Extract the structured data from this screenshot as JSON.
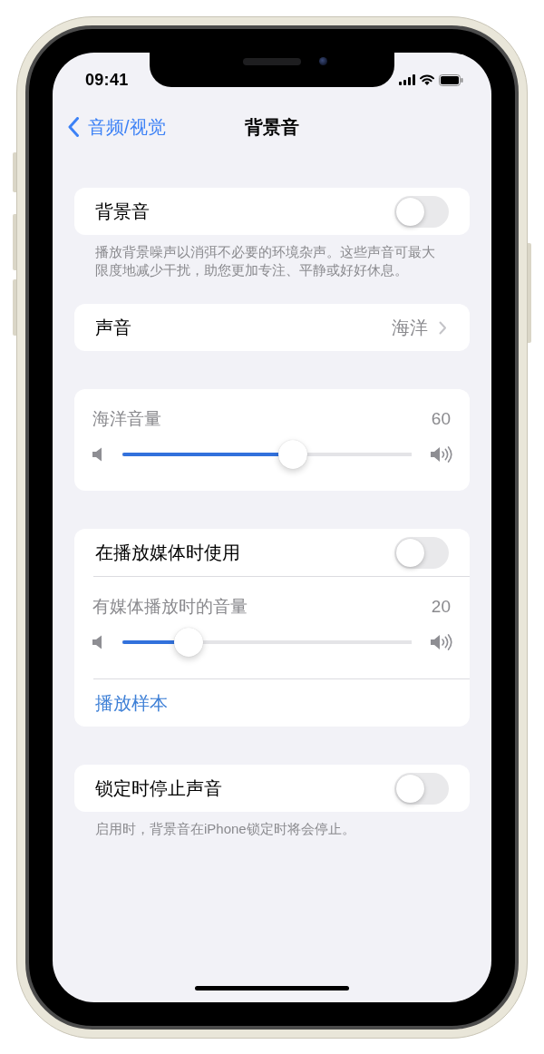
{
  "status_bar": {
    "time": "09:41"
  },
  "nav_bar": {
    "back_label": "音频/视觉",
    "title": "背景音"
  },
  "groups": [
    {
      "rows": [
        {
          "kind": "toggle",
          "label": "背景音",
          "on": false
        }
      ],
      "footer": "播放背景噪声以消弭不必要的环境杂声。这些声音可最大限度地减少干扰，助您更加专注、平静或好好休息。"
    },
    {
      "rows": [
        {
          "kind": "disclosure",
          "label": "声音",
          "value": "海洋"
        }
      ]
    },
    {
      "rows": [
        {
          "kind": "slider",
          "label": "海洋音量",
          "reading": "60",
          "level": 0.6
        }
      ]
    },
    {
      "rows": [
        {
          "kind": "toggle",
          "label": "在播放媒体时使用",
          "on": false
        },
        {
          "kind": "slider",
          "label": "有媒体播放时的音量",
          "reading": "20",
          "level": 0.2
        },
        {
          "kind": "link",
          "label": "播放样本"
        }
      ]
    },
    {
      "rows": [
        {
          "kind": "toggle",
          "label": "锁定时停止声音",
          "on": false
        }
      ],
      "footer": "启用时，背景音在iPhone锁定时将会停止。"
    }
  ]
}
